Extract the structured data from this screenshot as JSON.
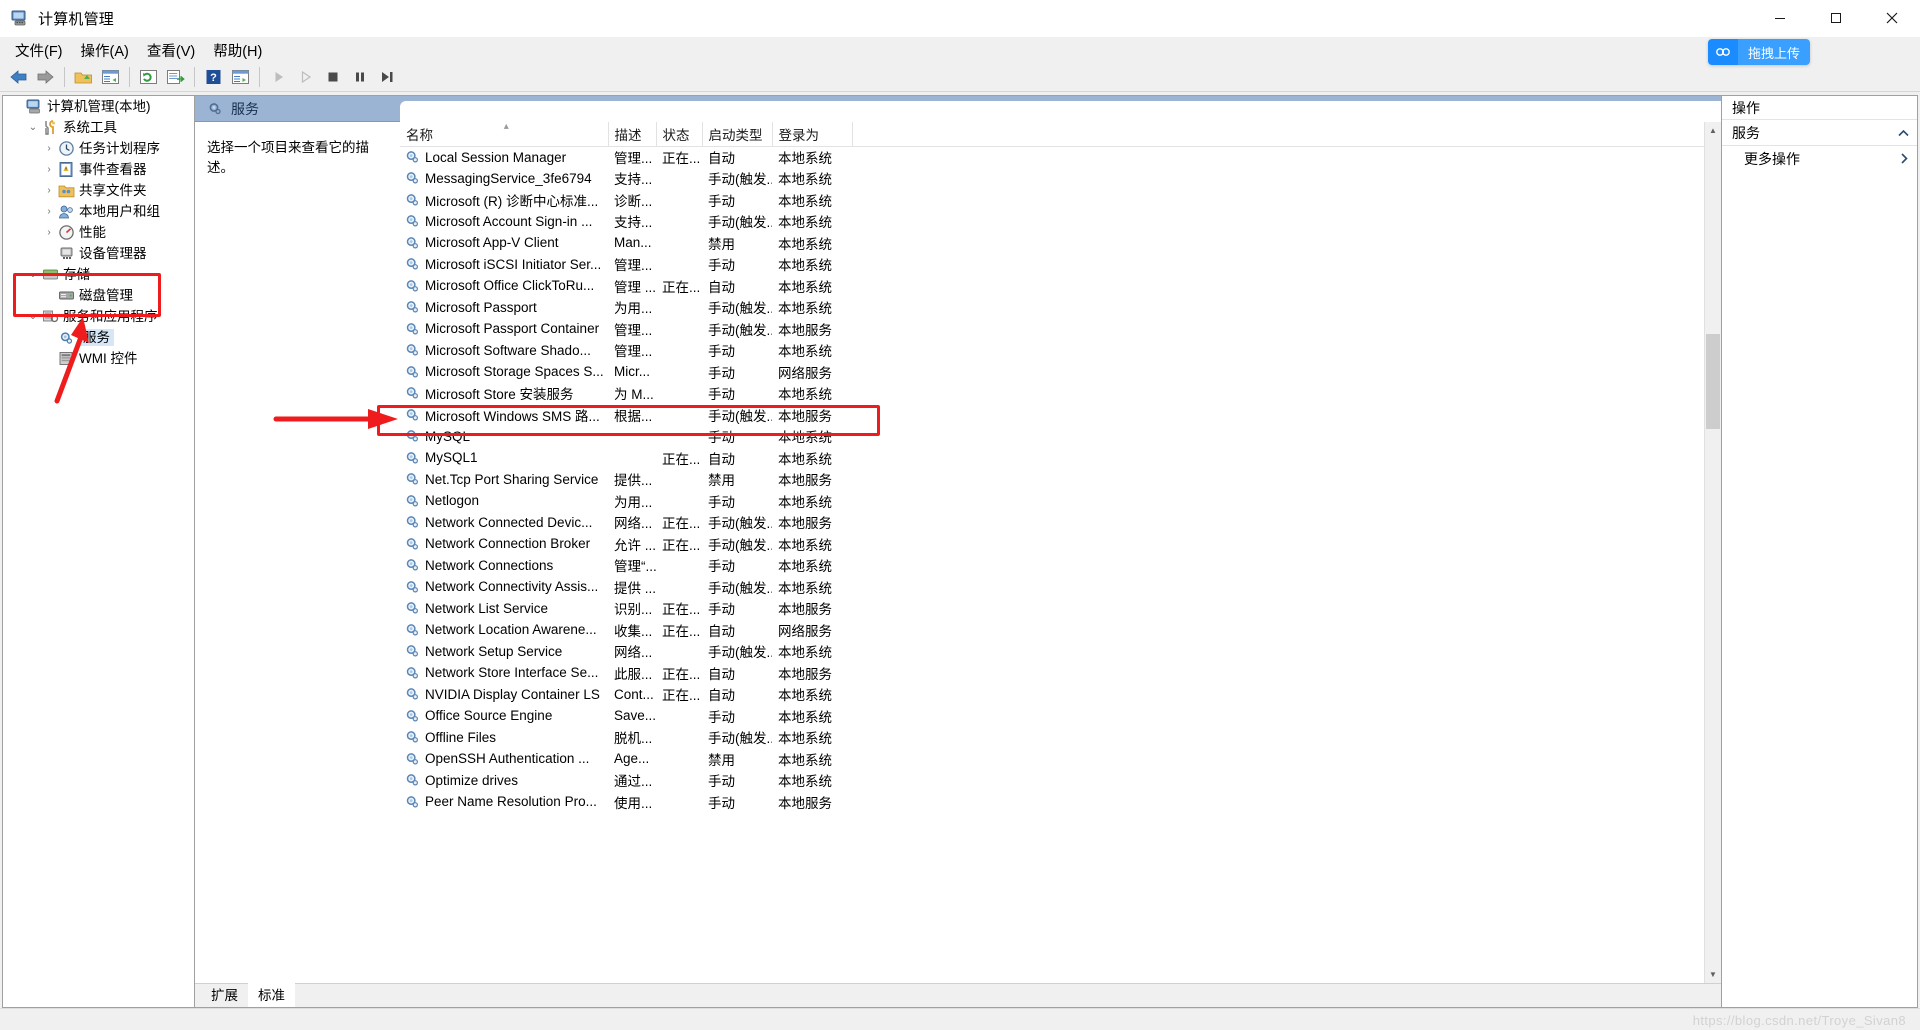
{
  "window": {
    "title": "计算机管理",
    "icon": "computer-management-icon",
    "minimize": "─",
    "maximize": "❐",
    "close": "✕"
  },
  "menubar": {
    "items": [
      {
        "label": "文件(F)",
        "name": "menu-file"
      },
      {
        "label": "操作(A)",
        "name": "menu-action"
      },
      {
        "label": "查看(V)",
        "name": "menu-view"
      },
      {
        "label": "帮助(H)",
        "name": "menu-help"
      }
    ]
  },
  "upload_pill": {
    "icon": "upload-cloud-icon",
    "label": "拖拽上传"
  },
  "toolbar": {
    "buttons": [
      {
        "name": "back-button",
        "icon": "arrow-left-icon"
      },
      {
        "name": "forward-button",
        "icon": "arrow-right-icon"
      },
      {
        "name": "up-one-level-button",
        "icon": "folder-up-icon"
      },
      {
        "name": "show-hide-console-tree-button",
        "icon": "console-tree-icon"
      },
      {
        "name": "refresh-button",
        "icon": "refresh-icon"
      },
      {
        "name": "export-list-button",
        "icon": "export-list-icon"
      },
      {
        "name": "help-button",
        "icon": "help-icon"
      },
      {
        "name": "show-hide-action-pane-button",
        "icon": "action-pane-icon"
      },
      {
        "name": "start-service-button",
        "icon": "play-icon"
      },
      {
        "name": "resume-service-button",
        "icon": "play-outline-icon"
      },
      {
        "name": "stop-service-button",
        "icon": "stop-icon"
      },
      {
        "name": "pause-service-button",
        "icon": "pause-icon"
      },
      {
        "name": "restart-service-button",
        "icon": "restart-icon"
      }
    ]
  },
  "tree": {
    "items": [
      {
        "label": "计算机管理(本地)",
        "icon": "computer-icon",
        "indent": 0,
        "twisty": "",
        "selected": false
      },
      {
        "label": "系统工具",
        "icon": "tools-icon",
        "indent": 1,
        "twisty": "⌄",
        "selected": false
      },
      {
        "label": "任务计划程序",
        "icon": "clock-icon",
        "indent": 2,
        "twisty": "›",
        "selected": false
      },
      {
        "label": "事件查看器",
        "icon": "event-viewer-icon",
        "indent": 2,
        "twisty": "›",
        "selected": false
      },
      {
        "label": "共享文件夹",
        "icon": "shared-folder-icon",
        "indent": 2,
        "twisty": "›",
        "selected": false
      },
      {
        "label": "本地用户和组",
        "icon": "users-icon",
        "indent": 2,
        "twisty": "›",
        "selected": false
      },
      {
        "label": "性能",
        "icon": "performance-icon",
        "indent": 2,
        "twisty": "›",
        "selected": false
      },
      {
        "label": "设备管理器",
        "icon": "device-manager-icon",
        "indent": 2,
        "twisty": "",
        "selected": false
      },
      {
        "label": "存储",
        "icon": "storage-icon",
        "indent": 1,
        "twisty": "⌄",
        "selected": false
      },
      {
        "label": "磁盘管理",
        "icon": "disk-management-icon",
        "indent": 2,
        "twisty": "",
        "selected": false
      },
      {
        "label": "服务和应用程序",
        "icon": "services-apps-icon",
        "indent": 1,
        "twisty": "⌄",
        "selected": false
      },
      {
        "label": "服务",
        "icon": "service-gear-icon",
        "indent": 2,
        "twisty": "",
        "selected": true
      },
      {
        "label": "WMI 控件",
        "icon": "wmi-icon",
        "indent": 2,
        "twisty": "",
        "selected": false
      }
    ]
  },
  "center": {
    "header_title": "服务",
    "header_icon": "service-gear-icon",
    "description_prompt": "选择一个项目来查看它的描述。",
    "columns": [
      {
        "key": "name",
        "label": "名称",
        "sorted": true
      },
      {
        "key": "desc",
        "label": "描述",
        "sorted": false
      },
      {
        "key": "status",
        "label": "状态",
        "sorted": false
      },
      {
        "key": "start",
        "label": "启动类型",
        "sorted": false
      },
      {
        "key": "logon",
        "label": "登录为",
        "sorted": false
      }
    ],
    "rows": [
      {
        "name": "Local Session Manager",
        "desc": "管理...",
        "status": "正在...",
        "start": "自动",
        "logon": "本地系统"
      },
      {
        "name": "MessagingService_3fe6794",
        "desc": "支持...",
        "status": "",
        "start": "手动(触发...",
        "logon": "本地系统"
      },
      {
        "name": "Microsoft (R) 诊断中心标准...",
        "desc": "诊断...",
        "status": "",
        "start": "手动",
        "logon": "本地系统"
      },
      {
        "name": "Microsoft Account Sign-in ...",
        "desc": "支持...",
        "status": "",
        "start": "手动(触发...",
        "logon": "本地系统"
      },
      {
        "name": "Microsoft App-V Client",
        "desc": "Man...",
        "status": "",
        "start": "禁用",
        "logon": "本地系统"
      },
      {
        "name": "Microsoft iSCSI Initiator Ser...",
        "desc": "管理...",
        "status": "",
        "start": "手动",
        "logon": "本地系统"
      },
      {
        "name": "Microsoft Office ClickToRu...",
        "desc": "管理 ...",
        "status": "正在...",
        "start": "自动",
        "logon": "本地系统"
      },
      {
        "name": "Microsoft Passport",
        "desc": "为用...",
        "status": "",
        "start": "手动(触发...",
        "logon": "本地系统"
      },
      {
        "name": "Microsoft Passport Container",
        "desc": "管理...",
        "status": "",
        "start": "手动(触发...",
        "logon": "本地服务"
      },
      {
        "name": "Microsoft Software Shado...",
        "desc": "管理...",
        "status": "",
        "start": "手动",
        "logon": "本地系统"
      },
      {
        "name": "Microsoft Storage Spaces S...",
        "desc": "Micr...",
        "status": "",
        "start": "手动",
        "logon": "网络服务"
      },
      {
        "name": "Microsoft Store 安装服务",
        "desc": "为 M...",
        "status": "",
        "start": "手动",
        "logon": "本地系统"
      },
      {
        "name": "Microsoft Windows SMS 路...",
        "desc": "根据...",
        "status": "",
        "start": "手动(触发...",
        "logon": "本地服务"
      },
      {
        "name": "MySQL",
        "desc": "",
        "status": "",
        "start": "手动",
        "logon": "本地系统",
        "highlighted": true
      },
      {
        "name": "MySQL1",
        "desc": "",
        "status": "正在...",
        "start": "自动",
        "logon": "本地系统"
      },
      {
        "name": "Net.Tcp Port Sharing Service",
        "desc": "提供...",
        "status": "",
        "start": "禁用",
        "logon": "本地服务"
      },
      {
        "name": "Netlogon",
        "desc": "为用...",
        "status": "",
        "start": "手动",
        "logon": "本地系统"
      },
      {
        "name": "Network Connected Devic...",
        "desc": "网络...",
        "status": "正在...",
        "start": "手动(触发...",
        "logon": "本地服务"
      },
      {
        "name": "Network Connection Broker",
        "desc": "允许 ...",
        "status": "正在...",
        "start": "手动(触发...",
        "logon": "本地系统"
      },
      {
        "name": "Network Connections",
        "desc": "管理“...",
        "status": "",
        "start": "手动",
        "logon": "本地系统"
      },
      {
        "name": "Network Connectivity Assis...",
        "desc": "提供 ...",
        "status": "",
        "start": "手动(触发...",
        "logon": "本地系统"
      },
      {
        "name": "Network List Service",
        "desc": "识别...",
        "status": "正在...",
        "start": "手动",
        "logon": "本地服务"
      },
      {
        "name": "Network Location Awarene...",
        "desc": "收集...",
        "status": "正在...",
        "start": "自动",
        "logon": "网络服务"
      },
      {
        "name": "Network Setup Service",
        "desc": "网络...",
        "status": "",
        "start": "手动(触发...",
        "logon": "本地系统"
      },
      {
        "name": "Network Store Interface Se...",
        "desc": "此服...",
        "status": "正在...",
        "start": "自动",
        "logon": "本地服务"
      },
      {
        "name": "NVIDIA Display Container LS",
        "desc": "Cont...",
        "status": "正在...",
        "start": "自动",
        "logon": "本地系统"
      },
      {
        "name": "Office  Source Engine",
        "desc": "Save...",
        "status": "",
        "start": "手动",
        "logon": "本地系统"
      },
      {
        "name": "Offline Files",
        "desc": "脱机...",
        "status": "",
        "start": "手动(触发...",
        "logon": "本地系统"
      },
      {
        "name": "OpenSSH Authentication ...",
        "desc": "Age...",
        "status": "",
        "start": "禁用",
        "logon": "本地系统"
      },
      {
        "name": "Optimize drives",
        "desc": "通过...",
        "status": "",
        "start": "手动",
        "logon": "本地系统"
      },
      {
        "name": "Peer Name Resolution Pro...",
        "desc": "使用...",
        "status": "",
        "start": "手动",
        "logon": "本地服务"
      }
    ],
    "tabs": [
      {
        "label": "扩展",
        "active": false,
        "name": "tab-extended"
      },
      {
        "label": "标准",
        "active": true,
        "name": "tab-standard"
      }
    ],
    "scrollbar": {
      "up_arrow": "▲",
      "down_arrow": "▼"
    }
  },
  "actions": {
    "title": "操作",
    "group_label": "服务",
    "group_collapse_icon": "chevron-up-icon",
    "more_actions_label": "更多操作",
    "more_actions_icon": "chevron-right-icon"
  },
  "watermark": "https://blog.csdn.net/Troye_Sivan8",
  "colors": {
    "mmc_header": "#9cb4d4",
    "annotation_red": "#ee1c1c",
    "selection_blue": "#d5e6f7",
    "accent_blue": "#3aa0ff"
  }
}
